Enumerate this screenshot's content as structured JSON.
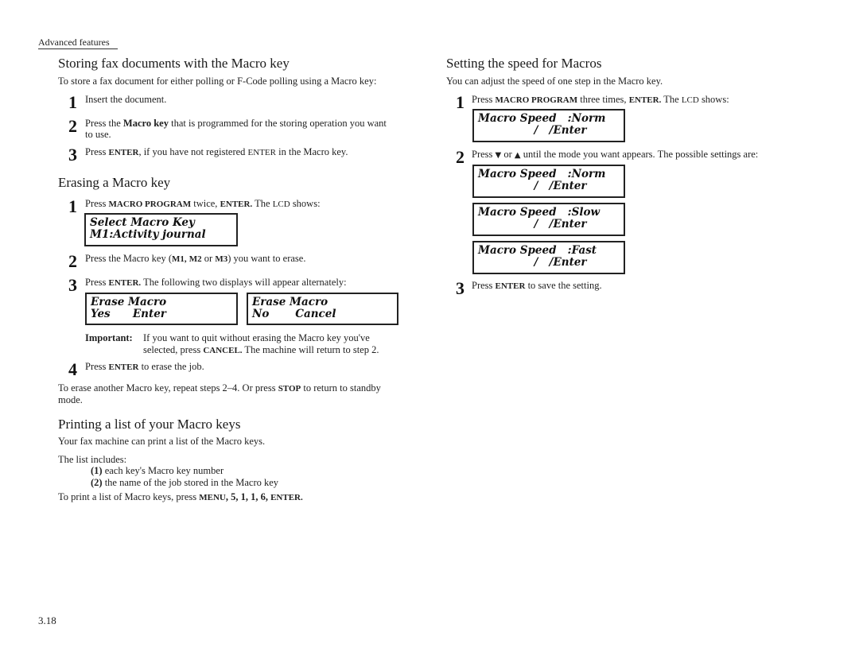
{
  "running_header": "Advanced features",
  "page_number": "3.18",
  "left": {
    "storing": {
      "title": "Storing fax documents with the Macro key",
      "intro": "To store a fax document for either polling or F-Code polling using a Macro key:",
      "steps": [
        {
          "num": "1",
          "text": "Insert the document."
        },
        {
          "num": "2",
          "pre": "Press the ",
          "bold": "Macro key",
          "post": " that is programmed for the storing operation you want",
          "line2": "to use."
        },
        {
          "num": "3",
          "pre": "Press ",
          "key": "ENTER",
          "mid": ", if you have not registered ",
          "key2": "ENTER",
          "post": " in the Macro key."
        }
      ]
    },
    "erasing": {
      "title": "Erasing a Macro key",
      "step1": {
        "num": "1",
        "pre": "Press ",
        "key": "MACRO PROGRAM",
        "mid": " twice, ",
        "key2": "ENTER.",
        "post": " The ",
        "lcd": "LCD",
        "end": " shows:"
      },
      "lcd1": {
        "line1": "Select Macro Key",
        "line2": "M1:Activity journal"
      },
      "step2": {
        "num": "2",
        "pre": "Press the Macro key (",
        "k1": "M1,",
        "k2": "M2",
        "mid": " or ",
        "k3": "M3",
        "post": ") you want to erase."
      },
      "step3": {
        "num": "3",
        "pre": "Press ",
        "key": "ENTER.",
        "post": " The following two displays will appear alternately:"
      },
      "lcd_yes": {
        "line1": "Erase Macro",
        "line2": "Yes      Enter"
      },
      "lcd_no": {
        "line1": "Erase Macro",
        "line2": "No       Cancel"
      },
      "important": {
        "label": "Important:",
        "line1": "If you want to quit without erasing the Macro key you've",
        "line2_pre": "selected, press ",
        "key": "CANCEL.",
        "line2_post": " The machine will return to step 2."
      },
      "step4": {
        "num": "4",
        "pre": "Press ",
        "key": "ENTER",
        "post": " to erase the job."
      },
      "outro": {
        "pre": "To erase another Macro key, repeat steps 2–4. Or press ",
        "key": "STOP",
        "post": " to return to standby",
        "line2": "mode."
      }
    },
    "printing": {
      "title": "Printing a list of your Macro keys",
      "intro": "Your fax machine can print a list of the Macro keys.",
      "list_intro": "The list includes:",
      "items": [
        {
          "num": "(1)",
          "text": " each key's Macro key number"
        },
        {
          "num": "(2)",
          "text": " the name of the job stored in the Macro key"
        }
      ],
      "outro": {
        "pre": "To print a list of Macro keys, press ",
        "key": "MENU",
        "seq": ", 5, 1, 1, 6, ",
        "key2": "ENTER."
      }
    }
  },
  "right": {
    "speed": {
      "title": "Setting the speed for Macros",
      "intro": "You can adjust the speed of one step in the Macro key.",
      "step1": {
        "num": "1",
        "pre": "Press ",
        "key": "MACRO PROGRAM",
        "mid": " three times, ",
        "key2": "ENTER.",
        "post": " The ",
        "lcd": "LCD",
        "end": " shows:"
      },
      "lcd_initial": {
        "line1": "Macro Speed   :Norm",
        "line2": "               /   /Enter"
      },
      "step2": {
        "num": "2",
        "pre": "Press ",
        "down": "▼",
        "mid": " or ",
        "up": "▲",
        "post": " until the mode you want appears. The possible settings are:"
      },
      "settings": [
        {
          "line1": "Macro Speed   :Norm",
          "line2": "               /   /Enter"
        },
        {
          "line1": "Macro Speed   :Slow",
          "line2": "               /   /Enter"
        },
        {
          "line1": "Macro Speed   :Fast",
          "line2": "               /   /Enter"
        }
      ],
      "step3": {
        "num": "3",
        "pre": "Press ",
        "key": "ENTER",
        "post": " to save the setting."
      }
    }
  }
}
